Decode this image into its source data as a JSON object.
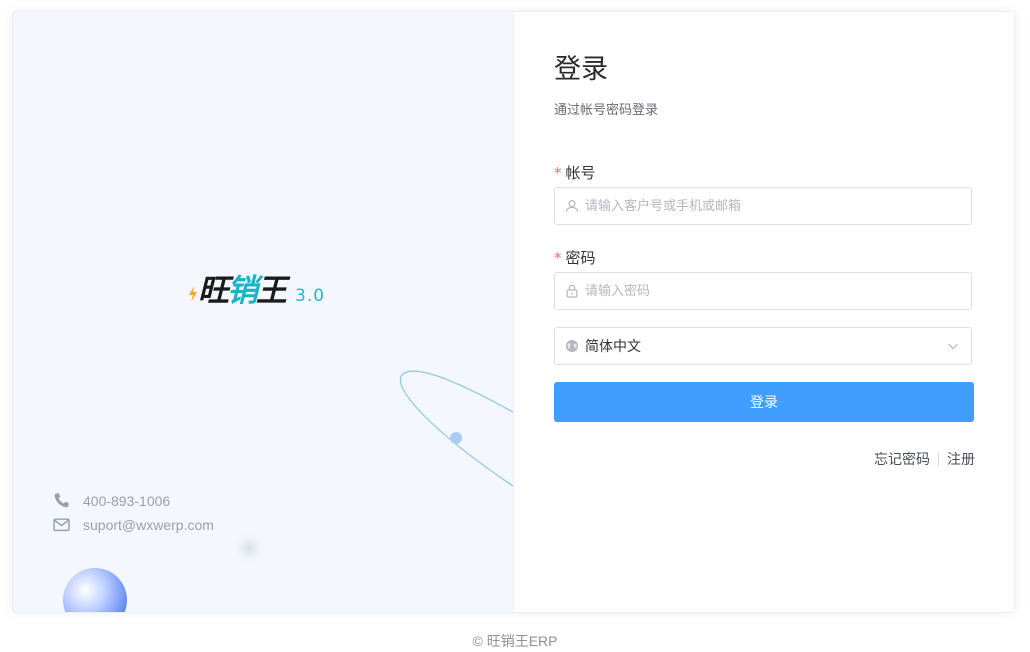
{
  "brand": {
    "logo_prefix": "旺",
    "logo_accent": "销",
    "logo_suffix": "王",
    "version": "3.0"
  },
  "contact": {
    "phone": "400-893-1006",
    "email": "suport@wxwerp.com"
  },
  "login": {
    "title": "登录",
    "subtitle": "通过帐号密码登录",
    "account_label": "帐号",
    "account_placeholder": "请输入客户号或手机或邮箱",
    "password_label": "密码",
    "password_placeholder": "请输入密码",
    "language_selected": "简体中文",
    "submit_label": "登录",
    "forgot_label": "忘记密码",
    "register_label": "注册",
    "required_mark": "*"
  },
  "footer": {
    "copyright": "© 旺销王ERP"
  },
  "colors": {
    "primary": "#409eff",
    "accent": "#1cb3c6",
    "required": "#f56c6c"
  },
  "icons": {
    "account": "user-icon",
    "password": "lock-icon",
    "language": "globe-icon",
    "dropdown": "chevron-down-icon",
    "phone": "phone-icon",
    "email": "mail-icon"
  }
}
